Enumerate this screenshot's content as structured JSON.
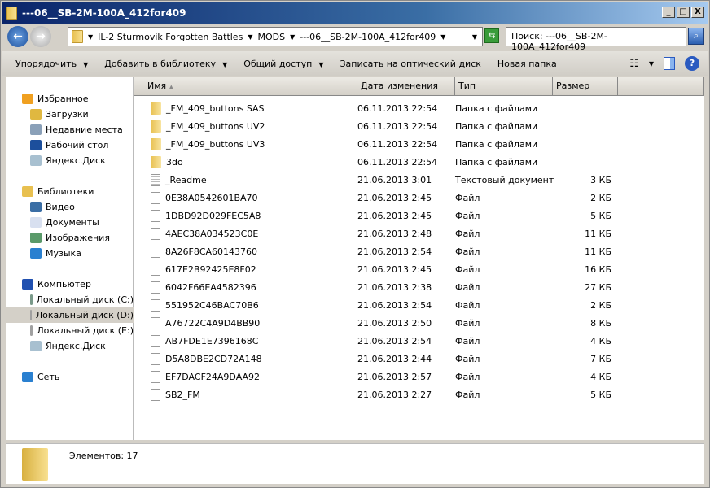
{
  "window": {
    "title": "---06__SB-2M-100A_412for409",
    "minimize": "_",
    "maximize": "□",
    "close": "X"
  },
  "nav": {
    "breadcrumbs": [
      "IL-2 Sturmovik Forgotten Battles",
      "MODS",
      "---06__SB-2M-100A_412for409"
    ],
    "search_text": "Поиск: ---06__SB-2M-100A_412for409"
  },
  "toolbar": {
    "organize": "Упорядочить",
    "add_library": "Добавить в библиотеку",
    "share": "Общий доступ",
    "burn": "Записать на оптический диск",
    "new_folder": "Новая папка"
  },
  "sidebar": [
    {
      "label": "Избранное",
      "icon": "star-icon",
      "color": "#f0a020",
      "group": true
    },
    {
      "label": "Загрузки",
      "icon": "downloads-icon",
      "color": "#e0b840"
    },
    {
      "label": "Недавние места",
      "icon": "recent-places-icon",
      "color": "#8aa0b8"
    },
    {
      "label": "Рабочий стол",
      "icon": "desktop-icon",
      "color": "#1c4f9c"
    },
    {
      "label": "Яндекс.Диск",
      "icon": "yandex-disk-icon",
      "color": "#a8c0d0"
    },
    {
      "label": "Библиотеки",
      "icon": "libraries-icon",
      "color": "#e8c050",
      "group": true
    },
    {
      "label": "Видео",
      "icon": "video-icon",
      "color": "#3a6ea5"
    },
    {
      "label": "Документы",
      "icon": "documents-icon",
      "color": "#d8e0f0"
    },
    {
      "label": "Изображения",
      "icon": "pictures-icon",
      "color": "#5a9a6a"
    },
    {
      "label": "Музыка",
      "icon": "music-icon",
      "color": "#2a80d0"
    },
    {
      "label": "Компьютер",
      "icon": "computer-icon",
      "color": "#2050b0",
      "group": true
    },
    {
      "label": "Локальный диск (C:)",
      "icon": "drive-c-icon",
      "color": "#7a9a8a"
    },
    {
      "label": "Локальный диск (D:)",
      "icon": "drive-d-icon",
      "color": "#a0a0a0",
      "selected": true
    },
    {
      "label": "Локальный диск (E:)",
      "icon": "drive-e-icon",
      "color": "#a0a0a0"
    },
    {
      "label": "Яндекс.Диск",
      "icon": "yandex-disk-icon",
      "color": "#a8c0d0"
    },
    {
      "label": "Сеть",
      "icon": "network-icon",
      "color": "#2a80d0",
      "group": true
    }
  ],
  "columns": [
    "Имя",
    "Дата изменения",
    "Тип",
    "Размер"
  ],
  "files": [
    {
      "name": "_FM_409_buttons SAS",
      "date": "06.11.2013 22:54",
      "type": "Папка с файлами",
      "size": "",
      "kind": "folder"
    },
    {
      "name": "_FM_409_buttons UV2",
      "date": "06.11.2013 22:54",
      "type": "Папка с файлами",
      "size": "",
      "kind": "folder"
    },
    {
      "name": "_FM_409_buttons UV3",
      "date": "06.11.2013 22:54",
      "type": "Папка с файлами",
      "size": "",
      "kind": "folder"
    },
    {
      "name": "3do",
      "date": "06.11.2013 22:54",
      "type": "Папка с файлами",
      "size": "",
      "kind": "folder"
    },
    {
      "name": "_Readme",
      "date": "21.06.2013 3:01",
      "type": "Текстовый документ",
      "size": "3 КБ",
      "kind": "text"
    },
    {
      "name": "0E38A0542601BA70",
      "date": "21.06.2013 2:45",
      "type": "Файл",
      "size": "2 КБ",
      "kind": "file"
    },
    {
      "name": "1DBD92D029FEC5A8",
      "date": "21.06.2013 2:45",
      "type": "Файл",
      "size": "5 КБ",
      "kind": "file"
    },
    {
      "name": "4AEC38A034523C0E",
      "date": "21.06.2013 2:48",
      "type": "Файл",
      "size": "11 КБ",
      "kind": "file"
    },
    {
      "name": "8A26F8CA60143760",
      "date": "21.06.2013 2:54",
      "type": "Файл",
      "size": "11 КБ",
      "kind": "file"
    },
    {
      "name": "617E2B92425E8F02",
      "date": "21.06.2013 2:45",
      "type": "Файл",
      "size": "16 КБ",
      "kind": "file"
    },
    {
      "name": "6042F66EA4582396",
      "date": "21.06.2013 2:38",
      "type": "Файл",
      "size": "27 КБ",
      "kind": "file"
    },
    {
      "name": "551952C46BAC70B6",
      "date": "21.06.2013 2:54",
      "type": "Файл",
      "size": "2 КБ",
      "kind": "file"
    },
    {
      "name": "A76722C4A9D4BB90",
      "date": "21.06.2013 2:50",
      "type": "Файл",
      "size": "8 КБ",
      "kind": "file"
    },
    {
      "name": "AB7FDE1E7396168C",
      "date": "21.06.2013 2:54",
      "type": "Файл",
      "size": "4 КБ",
      "kind": "file"
    },
    {
      "name": "D5A8DBE2CD72A148",
      "date": "21.06.2013 2:44",
      "type": "Файл",
      "size": "7 КБ",
      "kind": "file"
    },
    {
      "name": "EF7DACF24A9DAA92",
      "date": "21.06.2013 2:57",
      "type": "Файл",
      "size": "4 КБ",
      "kind": "file"
    },
    {
      "name": "SB2_FM",
      "date": "21.06.2013 2:27",
      "type": "Файл",
      "size": "5 КБ",
      "kind": "file"
    }
  ],
  "status": {
    "text": "Элементов: 17"
  }
}
